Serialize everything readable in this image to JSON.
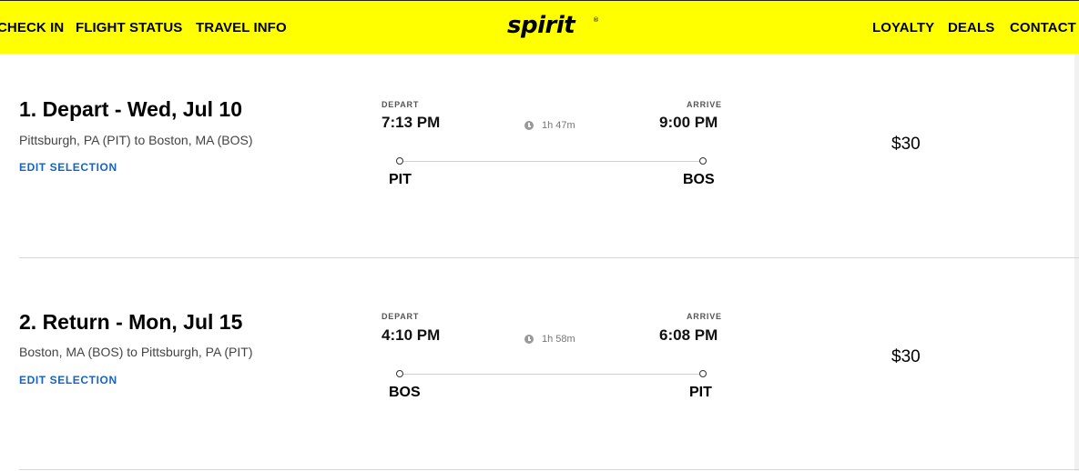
{
  "nav": {
    "left": [
      "CHECK IN",
      "FLIGHT STATUS",
      "TRAVEL INFO"
    ],
    "right": [
      "LOYALTY",
      "DEALS",
      "CONTACT US"
    ],
    "logo": "spirit",
    "logo_mark": "®"
  },
  "legs": [
    {
      "title": "1. Depart - Wed, Jul 10",
      "route": "Pittsburgh, PA (PIT) to Boston, MA (BOS)",
      "edit_label": "EDIT SELECTION",
      "depart_label": "DEPART",
      "arrive_label": "ARRIVE",
      "depart_time": "7:13 PM",
      "arrive_time": "9:00 PM",
      "duration": "1h 47m",
      "origin": "PIT",
      "destination": "BOS",
      "price": "$30"
    },
    {
      "title": "2. Return - Mon, Jul 15",
      "route": "Boston, MA (BOS) to Pittsburgh, PA (PIT)",
      "edit_label": "EDIT SELECTION",
      "depart_label": "DEPART",
      "arrive_label": "ARRIVE",
      "depart_time": "4:10 PM",
      "arrive_time": "6:08 PM",
      "duration": "1h 58m",
      "origin": "BOS",
      "destination": "PIT",
      "price": "$30"
    }
  ],
  "colors": {
    "header_bg": "#ffff00",
    "link": "#1564c0"
  }
}
